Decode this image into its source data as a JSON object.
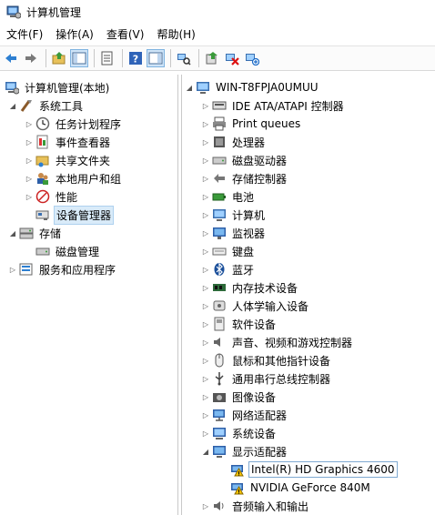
{
  "window": {
    "title": "计算机管理"
  },
  "menu": [
    {
      "name": "menu-file",
      "label": "文件(F)"
    },
    {
      "name": "menu-action",
      "label": "操作(A)"
    },
    {
      "name": "menu-view",
      "label": "查看(V)"
    },
    {
      "name": "menu-help",
      "label": "帮助(H)"
    }
  ],
  "toolbar": [
    "back-icon",
    "forward-icon",
    "up-folder-icon",
    "show-hide-tree-icon",
    "properties-icon",
    "help-icon",
    "action-pane-icon",
    "scan-hardware-icon",
    "update-driver-icon",
    "disable-device-icon",
    "uninstall-device-icon"
  ],
  "left_tree": {
    "root": "计算机管理(本地)",
    "items": [
      {
        "label": "系统工具",
        "level": 1
      },
      {
        "label": "任务计划程序",
        "level": 2
      },
      {
        "label": "事件查看器",
        "level": 2
      },
      {
        "label": "共享文件夹",
        "level": 2
      },
      {
        "label": "本地用户和组",
        "level": 2
      },
      {
        "label": "性能",
        "level": 2
      },
      {
        "label": "设备管理器",
        "level": 2,
        "selected": true
      },
      {
        "label": "存储",
        "level": 1
      },
      {
        "label": "磁盘管理",
        "level": 2
      },
      {
        "label": "服务和应用程序",
        "level": 1
      }
    ]
  },
  "right_tree": {
    "root": "WIN-T8FPJA0UMUU",
    "categories": [
      {
        "label": "IDE ATA/ATAPI 控制器",
        "icon": "ide-controller-icon"
      },
      {
        "label": "Print queues",
        "icon": "printer-icon"
      },
      {
        "label": "处理器",
        "icon": "processor-icon"
      },
      {
        "label": "磁盘驱动器",
        "icon": "disk-drive-icon"
      },
      {
        "label": "存储控制器",
        "icon": "storage-controller-icon"
      },
      {
        "label": "电池",
        "icon": "battery-icon"
      },
      {
        "label": "计算机",
        "icon": "computer-icon"
      },
      {
        "label": "监视器",
        "icon": "monitor-icon"
      },
      {
        "label": "键盘",
        "icon": "keyboard-icon"
      },
      {
        "label": "蓝牙",
        "icon": "bluetooth-icon"
      },
      {
        "label": "内存技术设备",
        "icon": "memory-device-icon"
      },
      {
        "label": "人体学输入设备",
        "icon": "hid-icon"
      },
      {
        "label": "软件设备",
        "icon": "software-device-icon"
      },
      {
        "label": "声音、视频和游戏控制器",
        "icon": "sound-icon"
      },
      {
        "label": "鼠标和其他指针设备",
        "icon": "mouse-icon"
      },
      {
        "label": "通用串行总线控制器",
        "icon": "usb-icon"
      },
      {
        "label": "图像设备",
        "icon": "camera-icon"
      },
      {
        "label": "网络适配器",
        "icon": "network-adapter-icon"
      },
      {
        "label": "系统设备",
        "icon": "system-device-icon"
      },
      {
        "label": "显示适配器",
        "icon": "display-adapter-icon",
        "expanded": true,
        "children": [
          {
            "label": "Intel(R) HD Graphics 4600",
            "warning": true,
            "focused": true
          },
          {
            "label": "NVIDIA GeForce 840M",
            "warning": true
          }
        ]
      },
      {
        "label": "音频输入和输出",
        "icon": "audio-io-icon"
      }
    ]
  },
  "colors": {
    "selection": "#d9ebf9",
    "warning": "#f5c400"
  }
}
